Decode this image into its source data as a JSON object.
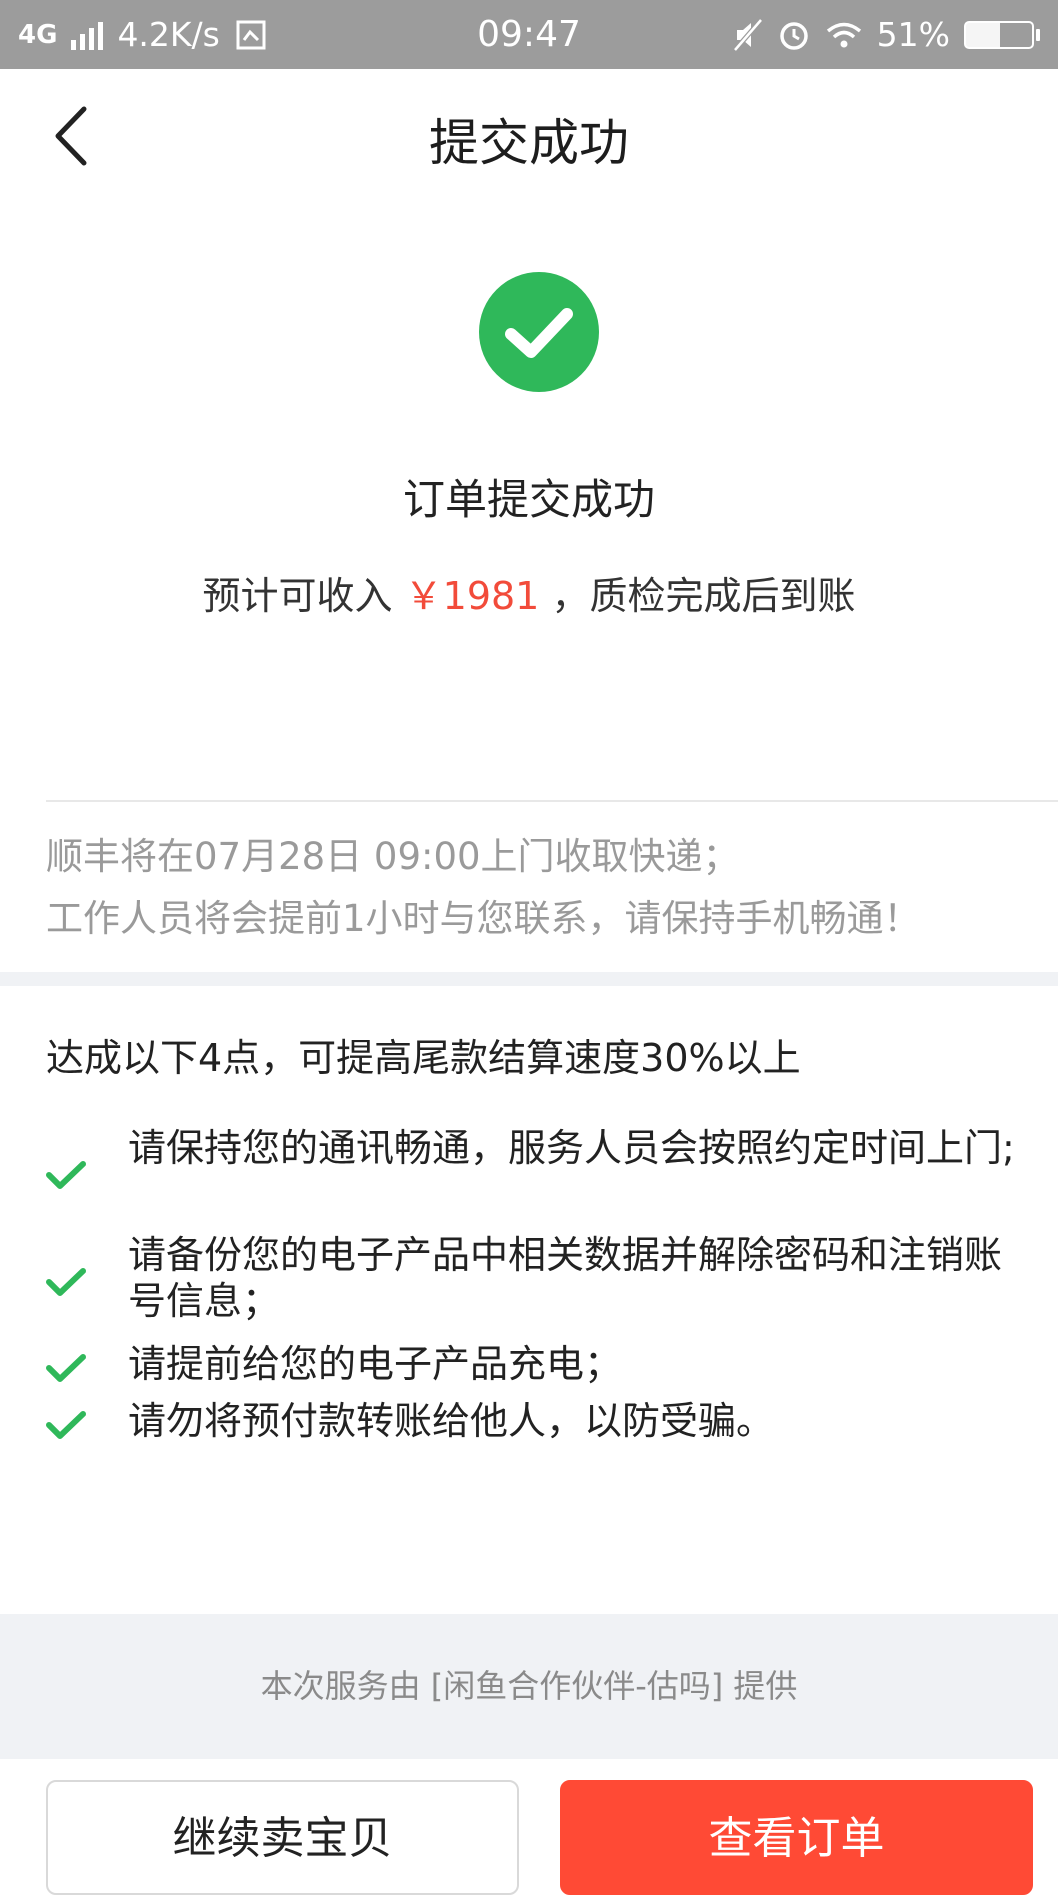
{
  "status_bar": {
    "network": "4G",
    "speed": "4.2K/s",
    "time": "09:47",
    "battery": "51%",
    "battery_level": 0.51
  },
  "header": {
    "title": "提交成功"
  },
  "success": {
    "title": "订单提交成功",
    "income_prefix": "预计可收入",
    "income_amount": "￥1981",
    "income_suffix": "，质检完成后到账",
    "icon_color": "#2fb85a"
  },
  "pickup": {
    "line1": "顺丰将在07月28日 09:00上门收取快递；",
    "line2": "工作人员将会提前1小时与您联系，请保持手机畅通！"
  },
  "tips": {
    "heading": "达成以下4点，可提高尾款结算速度30%以上",
    "items": [
      {
        "text": "请保持您的通讯畅通，服务人员会按照约定时间上门;"
      },
      {
        "text": "请备份您的电子产品中相关数据并解除密码和注销账号信息；"
      },
      {
        "text": "请提前给您的电子产品充电；"
      },
      {
        "text": "请勿将预付款转账给他人，以防受骗。"
      }
    ],
    "check_color": "#2fb85a"
  },
  "provider_note": "本次服务由 [闲鱼合作伙伴-估吗] 提供",
  "buttons": {
    "continue": "继续卖宝贝",
    "view_order": "查看订单",
    "accent": "#ff4a35"
  }
}
